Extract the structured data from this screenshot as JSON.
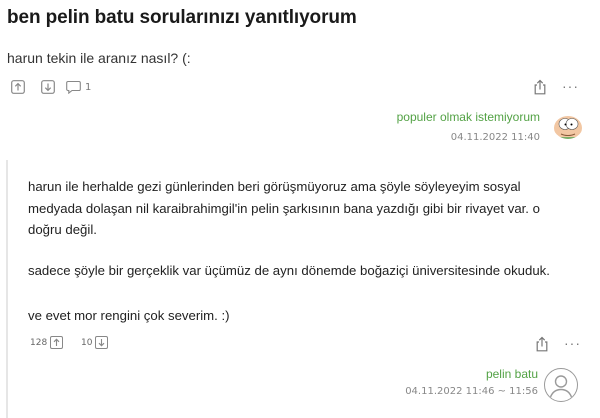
{
  "topic": {
    "title": "ben pelin batu sorularınızı yanıtlıyorum"
  },
  "entry1": {
    "text": "harun tekin ile aranız nasıl? (:",
    "comment_count": "1",
    "author": "populer olmak istemiyorum",
    "date": "04.11.2022 11:40",
    "more": "···"
  },
  "reply": {
    "p1": "harun ile herhalde gezi günlerinden beri görüşmüyoruz ama şöyle söyleyeyim sosyal medyada dolaşan nil karaibrahimgil'in pelin şarkısının bana yazdığı gibi bir rivayet var. o doğru değil.",
    "p2": "sadece şöyle bir gerçeklik var üçümüz de aynı dönemde boğaziçi üniversitesinde okuduk.",
    "p3": "ve evet mor rengini çok severim. :)",
    "upvotes": "128",
    "downvotes": "10",
    "author": "pelin batu",
    "date": "04.11.2022 11:46 ~ 11:56",
    "more": "···"
  },
  "colors": {
    "author": "#53a245",
    "muted": "#888888",
    "text": "#222222"
  },
  "icons": {
    "upvote": "arrow-up-box-icon",
    "downvote": "arrow-down-box-icon",
    "comment": "speech-bubble-icon",
    "share": "share-icon",
    "more": "ellipsis-icon",
    "avatar1": "cartoon-avatar",
    "avatar2": "default-user-avatar"
  }
}
